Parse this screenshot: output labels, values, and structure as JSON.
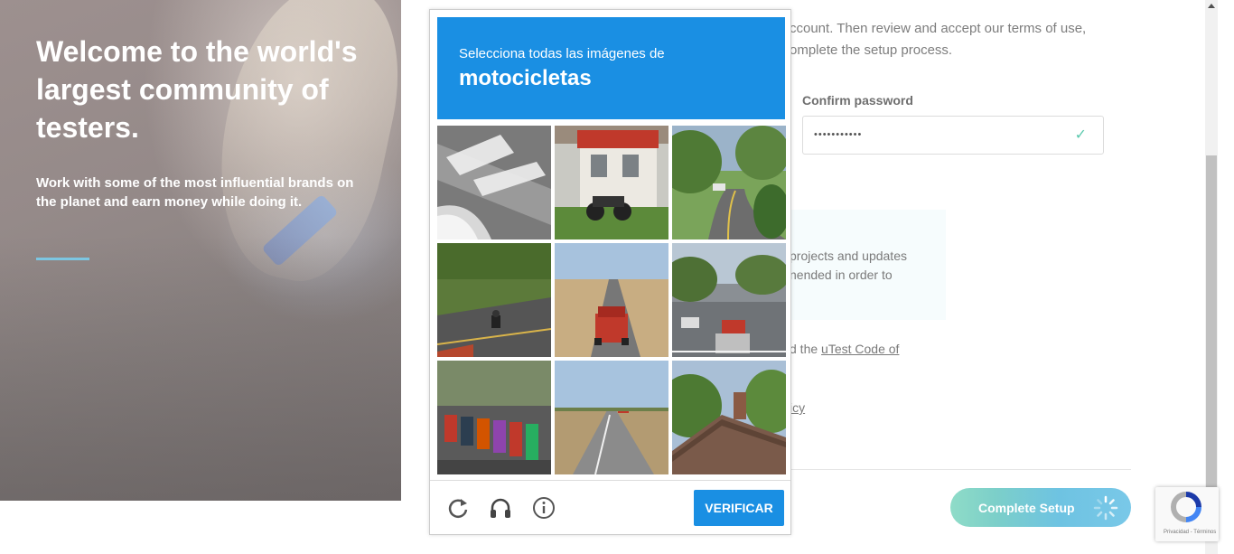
{
  "hero": {
    "title": "Welcome to the world's largest community of testers.",
    "subtitle": "Work with some of the most influential brands on the planet and earn money while doing it."
  },
  "form": {
    "intro_line1": "ccount. Then review and accept our terms of use,",
    "intro_line2": "omplete the setup process.",
    "confirm_password_label": "Confirm password",
    "confirm_password_value": "•••••••••••",
    "info_line1": "projects and updates",
    "info_line2": "nended in order to",
    "code_prefix": "d the ",
    "code_link": "uTest Code of",
    "policy_fragment": "icy",
    "complete_button": "Complete Setup"
  },
  "captcha": {
    "instruction": "Selecciona todas las imágenes de",
    "target": "motocicletas",
    "verify_button": "VERIFICAR",
    "tiles": [
      "road-marking",
      "motorcycle-by-building",
      "curved-road",
      "motorcycle-on-road",
      "red-truck-on-road",
      "street-intersection",
      "row-of-motorcycles",
      "highway",
      "house-roof"
    ]
  },
  "recaptcha_badge": {
    "terms": "Privacidad - Términos"
  },
  "colors": {
    "captcha_blue": "#1a8fe3",
    "hero_rule": "#7cc6e2",
    "check_green": "#5cc9ae"
  }
}
